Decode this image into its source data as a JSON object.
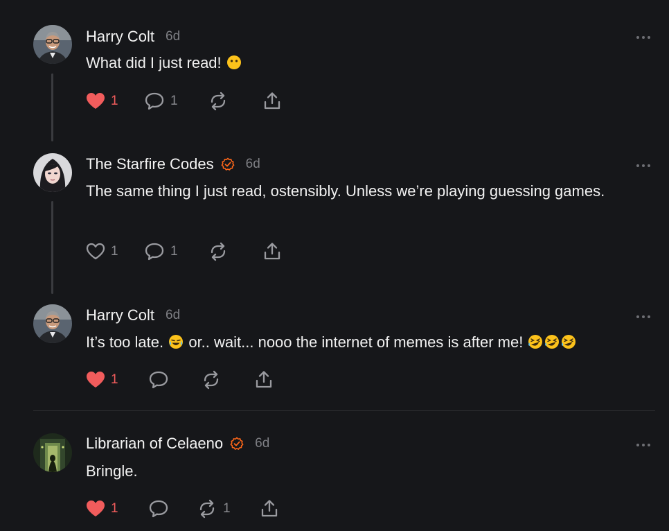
{
  "comments": [
    {
      "author": "Harry Colt",
      "time": "6d",
      "verified": false,
      "text_segments": [
        "What did I just read! "
      ],
      "likes": "1",
      "liked": true,
      "replies": "1",
      "restacks": ""
    },
    {
      "author": "The Starfire Codes",
      "time": "6d",
      "verified": true,
      "text_segments": [
        "The same thing I just read, ostensibly. Unless we’re playing guessing games."
      ],
      "likes": "1",
      "liked": false,
      "replies": "1",
      "restacks": ""
    },
    {
      "author": "Harry Colt",
      "time": "6d",
      "verified": false,
      "text_segments": [
        "It’s too late. ",
        " or.. wait... nooo the internet of memes is after me! "
      ],
      "likes": "1",
      "liked": true,
      "replies": "",
      "restacks": ""
    },
    {
      "author": "Librarian of Celaeno",
      "time": "6d",
      "verified": true,
      "text_segments": [
        "Bringle."
      ],
      "likes": "1",
      "liked": true,
      "replies": "",
      "restacks": "1"
    }
  ],
  "colors": {
    "background": "#16171a",
    "liked": "#f15c5c",
    "verified": "#ff6719",
    "muted": "#8a8b90"
  },
  "icons": [
    "heart-icon",
    "comment-icon",
    "restack-icon",
    "share-icon",
    "more-icon",
    "verified-icon",
    "emoji-icon"
  ]
}
